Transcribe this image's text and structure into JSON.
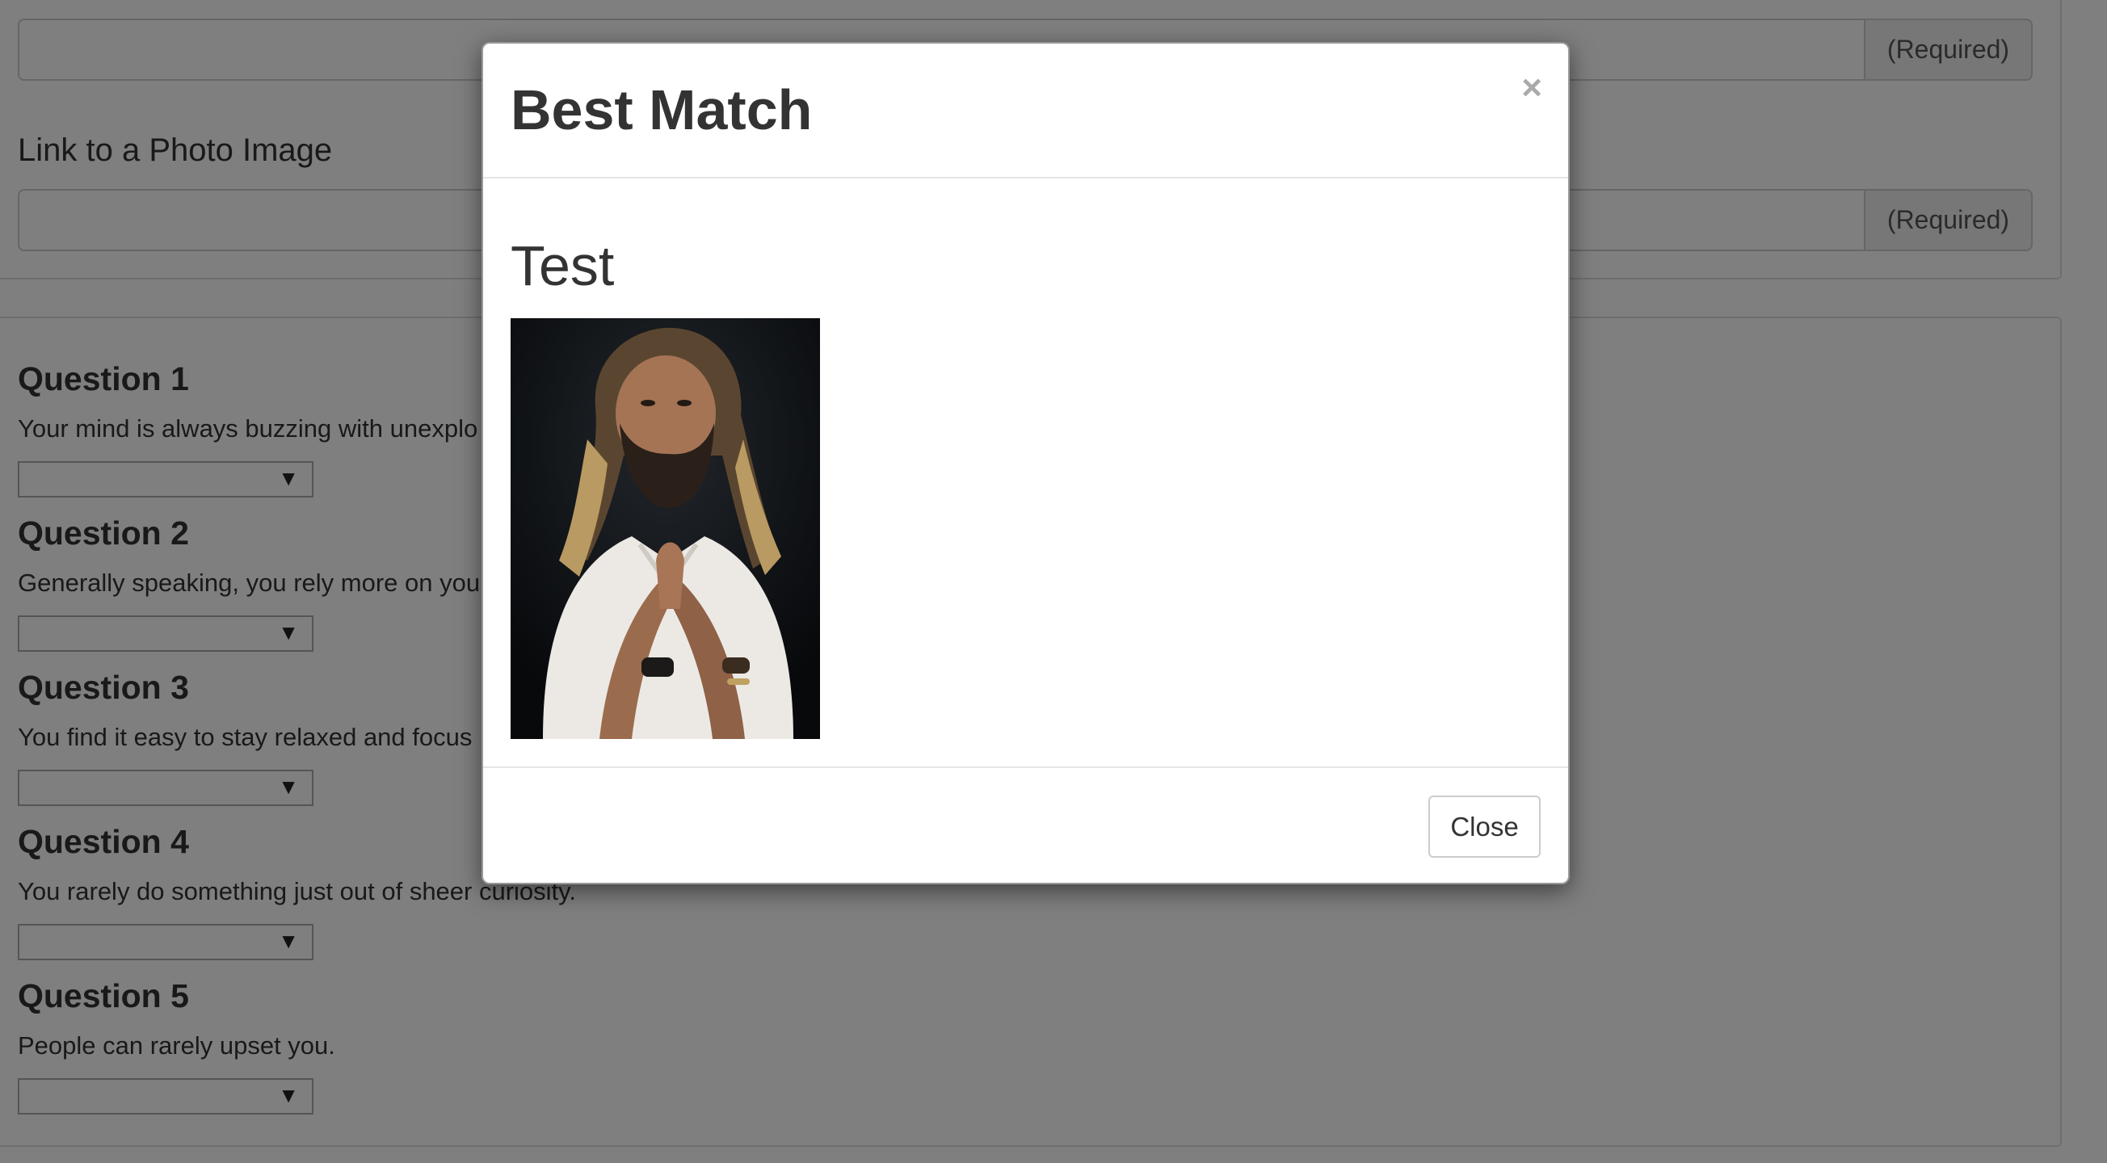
{
  "form": {
    "name_field": {
      "value": "",
      "addon": "(Required)"
    },
    "photo_field": {
      "label": "Link to a Photo Image",
      "value": "",
      "addon": "(Required)"
    }
  },
  "questions": [
    {
      "title": "Question 1",
      "text": "Your mind is always buzzing with unexplo"
    },
    {
      "title": "Question 2",
      "text": "Generally speaking, you rely more on you"
    },
    {
      "title": "Question 3",
      "text": "You find it easy to stay relaxed and focus"
    },
    {
      "title": "Question 4",
      "text": "You rarely do something just out of sheer curiosity."
    },
    {
      "title": "Question 5",
      "text": "People can rarely upset you."
    }
  ],
  "modal": {
    "title": "Best Match",
    "close_symbol": "×",
    "match_name": "Test",
    "photo_description_icon": "person-photo",
    "close_button_label": "Close"
  },
  "colors": {
    "backdrop": "#000000",
    "addon_bg": "#eeeeee",
    "text": "#333333"
  }
}
